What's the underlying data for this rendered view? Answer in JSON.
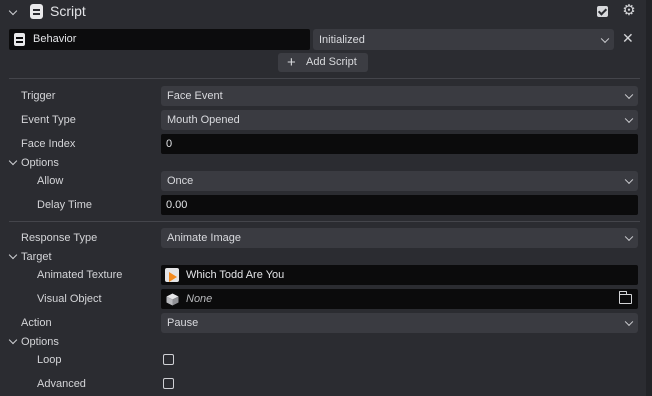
{
  "header": {
    "title": "Script"
  },
  "behavior": {
    "field_value": "Behavior",
    "status": "Initialized"
  },
  "add_script": {
    "label": "Add Script"
  },
  "form": {
    "trigger": {
      "label": "Trigger",
      "value": "Face Event"
    },
    "event_type": {
      "label": "Event Type",
      "value": "Mouth Opened"
    },
    "face_index": {
      "label": "Face Index",
      "value": "0"
    },
    "options1": {
      "label": "Options"
    },
    "allow": {
      "label": "Allow",
      "value": "Once"
    },
    "delay_time": {
      "label": "Delay Time",
      "value": "0.00"
    },
    "response_type": {
      "label": "Response Type",
      "value": "Animate Image"
    },
    "target": {
      "label": "Target"
    },
    "animated_texture": {
      "label": "Animated Texture",
      "value": "Which Todd Are You"
    },
    "visual_object": {
      "label": "Visual Object",
      "value": "None"
    },
    "action": {
      "label": "Action",
      "value": "Pause"
    },
    "options2": {
      "label": "Options"
    },
    "loop": {
      "label": "Loop",
      "checked": false
    },
    "advanced": {
      "label": "Advanced",
      "checked": false
    }
  }
}
